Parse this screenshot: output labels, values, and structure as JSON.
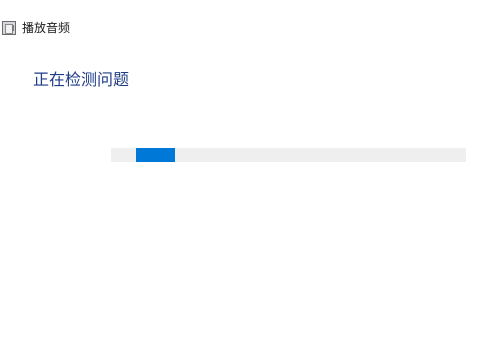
{
  "window": {
    "title": "播放音频",
    "icon": "app-icon"
  },
  "main": {
    "status_heading": "正在检测问题"
  },
  "progress": {
    "mode": "indeterminate",
    "accent_color": "#0078d7",
    "track_color": "#efefef"
  }
}
